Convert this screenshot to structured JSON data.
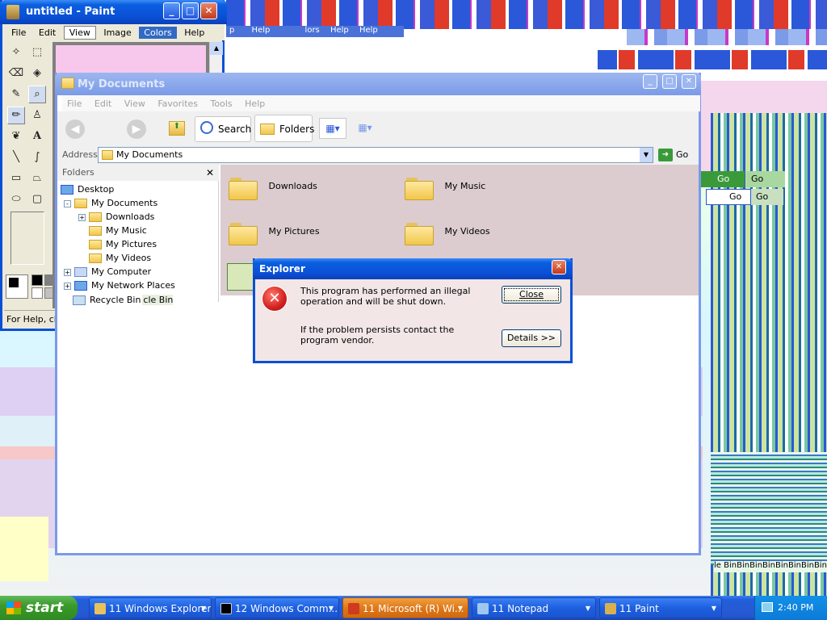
{
  "paint": {
    "title": "untitled - Paint",
    "menu": [
      "File",
      "Edit",
      "View",
      "Image",
      "Colors",
      "Help"
    ],
    "status": "For Help, click Help Topics on the Help Menu.",
    "status_visible": "For Help, clic|p, clic"
  },
  "explorer": {
    "title": "My Documents",
    "menu": [
      "File",
      "Edit",
      "View",
      "Favorites",
      "Tools",
      "Help"
    ],
    "toolbar": {
      "back": "Back",
      "search": "Search",
      "folders": "Folders"
    },
    "address_label": "Address",
    "address_value": "My Documents",
    "go_label": "Go",
    "folders_pane_title": "Folders",
    "tree": [
      {
        "label": "Desktop",
        "level": 0,
        "expander": ""
      },
      {
        "label": "My Documents",
        "level": 1,
        "expander": "-"
      },
      {
        "label": "Downloads",
        "level": 2,
        "expander": "+"
      },
      {
        "label": "My Music",
        "level": 2,
        "expander": ""
      },
      {
        "label": "My Pictures",
        "level": 2,
        "expander": ""
      },
      {
        "label": "My Videos",
        "level": 2,
        "expander": ""
      },
      {
        "label": "My Computer",
        "level": 1,
        "expander": "+"
      },
      {
        "label": "My Network Places",
        "level": 1,
        "expander": "+"
      },
      {
        "label": "Recycle Bin",
        "level": 1,
        "expander": ""
      }
    ],
    "tree_ghost": "cle Bin",
    "items": [
      {
        "label": "Downloads",
        "icon": "folder-icon"
      },
      {
        "label": "My Music",
        "icon": "music-folder-icon"
      },
      {
        "label": "My Pictures",
        "icon": "pictures-folder-icon"
      },
      {
        "label": "My Videos",
        "icon": "videos-folder-icon"
      }
    ]
  },
  "dialog": {
    "title": "Explorer",
    "message1": "This program has performed an illegal operation and will be shut down.",
    "message2": "If the problem persists contact the program vendor.",
    "close_button": "Close",
    "details_button": "Details >>"
  },
  "ghost": {
    "go_labels": [
      "Go",
      "Go",
      "Go",
      "Go"
    ],
    "menu_fragments": [
      "p",
      "Help",
      "lors",
      "Help",
      "Help"
    ],
    "bin_text": "le BinBinBinBinBinBinBinBin"
  },
  "taskbar": {
    "start": "start",
    "buttons": [
      {
        "label": "11 Windows Explorer",
        "color": "#e8c25a"
      },
      {
        "label": "12 Windows Comm...",
        "color": "#000000"
      },
      {
        "label": "11 Microsoft (R) Wi...",
        "color": "#d03a20"
      },
      {
        "label": "11 Notepad",
        "color": "#9fc6ef"
      },
      {
        "label": "11 Paint",
        "color": "#d8b050"
      }
    ],
    "clock": "2:40 PM"
  },
  "colors": {
    "xp_blue": "#0a50d6",
    "taskbar_blue": "#245edb",
    "start_green": "#3a9a2a",
    "error_red": "#d32020",
    "dialog_bg": "#f0e4e4"
  }
}
